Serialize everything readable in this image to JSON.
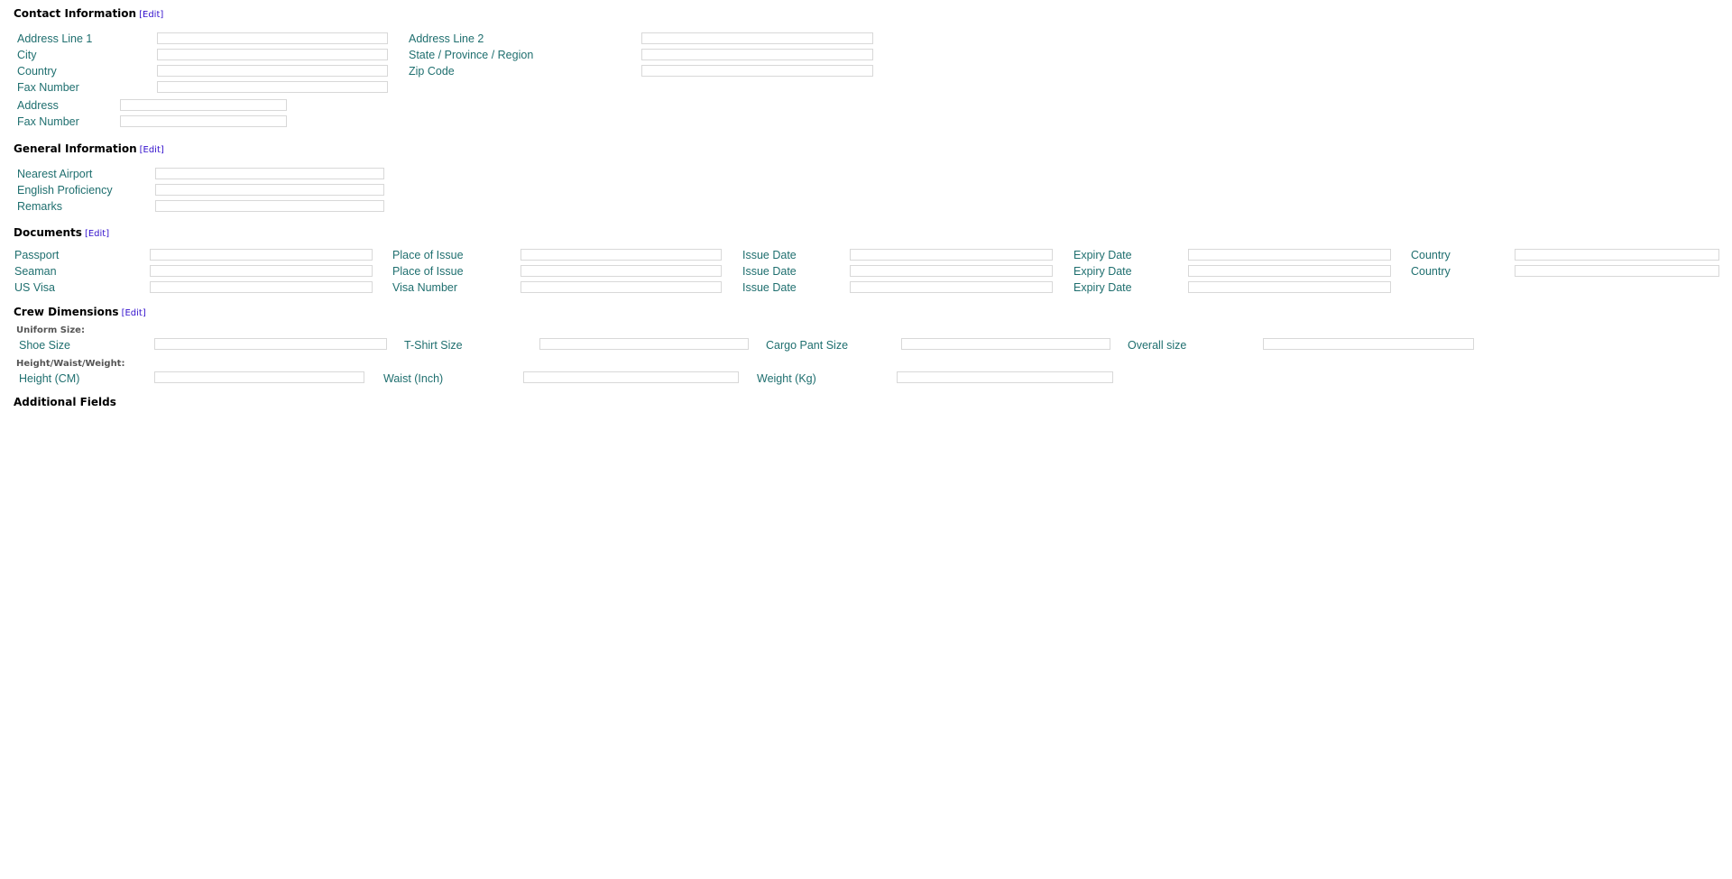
{
  "contact": {
    "title": "Contact Information",
    "edit": "[Edit]",
    "address_line_1": "Address Line 1",
    "address_line_2": "Address Line 2",
    "city": "City",
    "state": "State / Province / Region",
    "country": "Country",
    "zip": "Zip Code",
    "fax": "Fax Number",
    "address": "Address",
    "fax2": "Fax Number"
  },
  "general": {
    "title": "General Information",
    "edit": "[Edit]",
    "nearest_airport": "Nearest Airport",
    "english": "English Proficiency",
    "remarks": "Remarks"
  },
  "documents": {
    "title": "Documents",
    "edit": "[Edit]",
    "rows": [
      {
        "name": "Passport",
        "col2": "Place of Issue",
        "col3": "Issue Date",
        "col4": "Expiry Date",
        "col5": "Country"
      },
      {
        "name": "Seaman",
        "col2": "Place of Issue",
        "col3": "Issue Date",
        "col4": "Expiry Date",
        "col5": "Country"
      },
      {
        "name": "US Visa",
        "col2": "Visa Number",
        "col3": "Issue Date",
        "col4": "Expiry Date"
      }
    ]
  },
  "crew": {
    "title": "Crew Dimensions",
    "edit": "[Edit]",
    "uniform_heading": "Uniform Size:",
    "shoe": "Shoe Size",
    "tshirt": "T-Shirt Size",
    "cargo": "Cargo Pant Size",
    "overall": "Overall size",
    "hww_heading": "Height/Waist/Weight:",
    "height": "Height (CM)",
    "waist": "Waist (Inch)",
    "weight": "Weight (Kg)"
  },
  "additional": {
    "title": "Additional Fields"
  }
}
